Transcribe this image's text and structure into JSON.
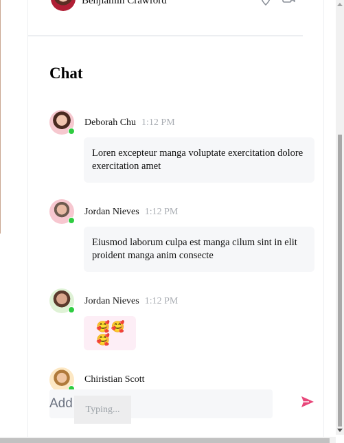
{
  "header": {
    "name": "Benjiamin Crawford",
    "icons": [
      "location-pin-icon",
      "video-camera-icon",
      "more-icon"
    ]
  },
  "chat": {
    "title": "Chat",
    "messages": [
      {
        "sender": "Deborah Chu",
        "time": "1:12 PM",
        "text": "Loren excepteur manga voluptate exercitation dolore exercitation amet",
        "online": true
      },
      {
        "sender": "Jordan Nieves",
        "time": "1:12 PM",
        "text": "Eiusmod laborum culpa est manga cilum sint in elit proident manga anim consecte",
        "online": true
      },
      {
        "sender": "Jordan Nieves",
        "time": "1:12 PM",
        "emoji": "🥰🥰🥰",
        "online": true
      },
      {
        "sender": "Chiristian Scott",
        "online": true
      }
    ]
  },
  "composer": {
    "placeholder": "Add message",
    "typing_label": "Typing..."
  },
  "colors": {
    "online": "#2ecc40",
    "send": "#e8477a",
    "bubble": "#f6f7f9",
    "emoji_bubble": "#fdeef6"
  }
}
